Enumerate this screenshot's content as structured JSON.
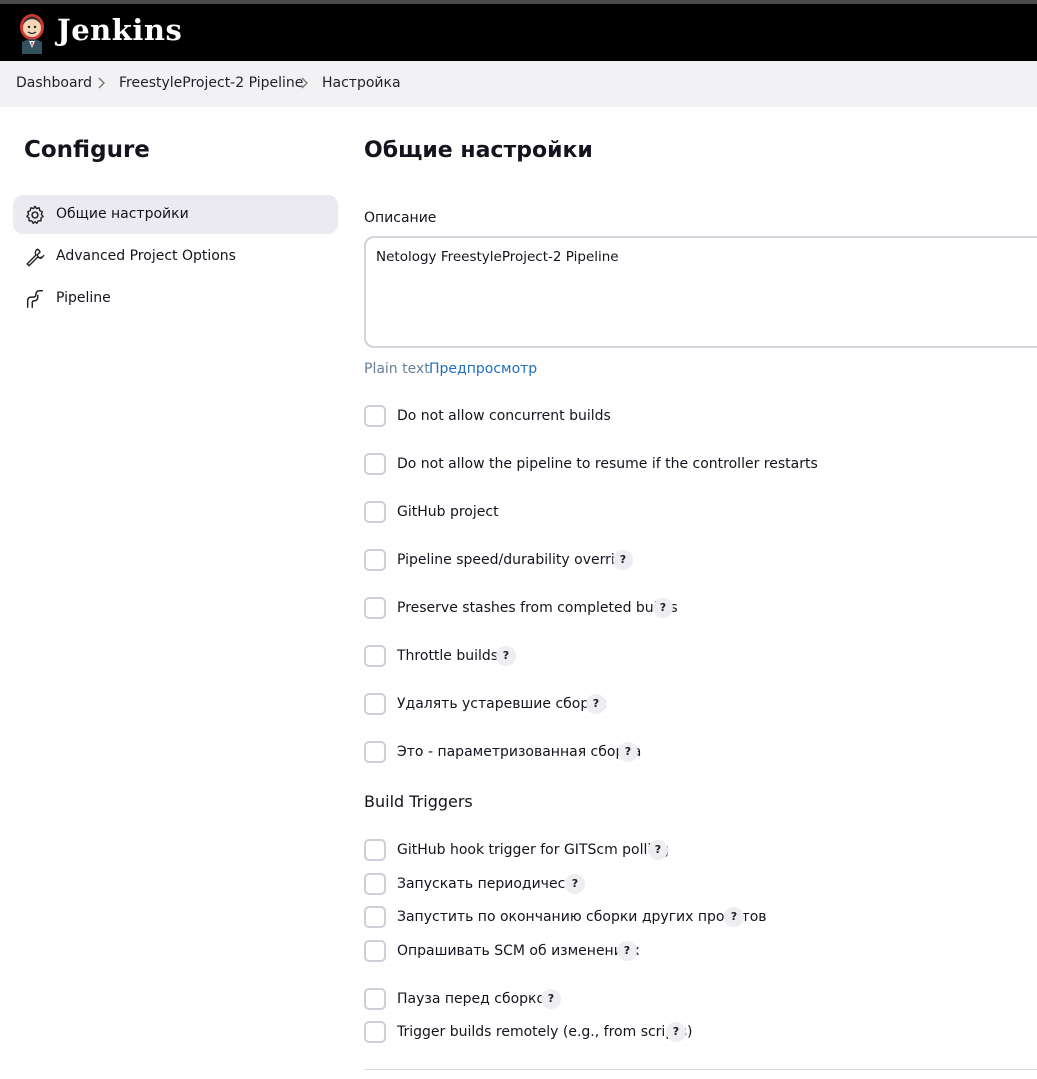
{
  "header": {
    "brand": "Jenkins"
  },
  "breadcrumbs": [
    "Dashboard",
    "FreestyleProject-2 Pipeline",
    "Настройка"
  ],
  "sidebar": {
    "title": "Configure",
    "items": [
      {
        "label": "Общие настройки",
        "icon": "gear-icon",
        "active": true
      },
      {
        "label": "Advanced Project Options",
        "icon": "wrench-icon",
        "active": false
      },
      {
        "label": "Pipeline",
        "icon": "pipeline-icon",
        "active": false
      }
    ]
  },
  "main": {
    "title": "Общие настройки",
    "description": {
      "label": "Описание",
      "value": "Netology FreestyleProject-2 Pipeline",
      "plain_text": "Plain text",
      "preview": "Предпросмотр"
    },
    "options": [
      {
        "label": "Do not allow concurrent builds",
        "help": false,
        "checked": false
      },
      {
        "label": "Do not allow the pipeline to resume if the controller restarts",
        "help": false,
        "checked": false
      },
      {
        "label": "GitHub project",
        "help": false,
        "checked": false
      },
      {
        "label": "Pipeline speed/durability override",
        "help": true,
        "checked": false
      },
      {
        "label": "Preserve stashes from completed builds",
        "help": true,
        "checked": false
      },
      {
        "label": "Throttle builds",
        "help": true,
        "checked": false
      },
      {
        "label": "Удалять устаревшие сборки",
        "help": true,
        "checked": false
      },
      {
        "label": "Это - параметризованная сборка",
        "help": true,
        "checked": false
      }
    ],
    "build_triggers": {
      "title": "Build Triggers",
      "items": [
        {
          "label": "GitHub hook trigger for GITScm polling",
          "help": true,
          "checked": false
        },
        {
          "label": "Запускать периодически",
          "help": true,
          "checked": false
        },
        {
          "label": "Запустить по окончанию сборки других проектов",
          "help": true,
          "checked": false
        },
        {
          "label": "Опрашивать SCM об изменениях",
          "help": true,
          "checked": false
        },
        {
          "label": "Пауза перед сборкой",
          "help": true,
          "checked": false
        },
        {
          "label": "Trigger builds remotely (e.g., from scripts)",
          "help": true,
          "checked": false
        }
      ]
    },
    "help_glyph": "?"
  },
  "colors": {
    "header_bg": "#000000",
    "breadcrumb_bg": "#f2f2f4",
    "link": "#1f6fc2",
    "active_nav": "#eaeaf0"
  }
}
